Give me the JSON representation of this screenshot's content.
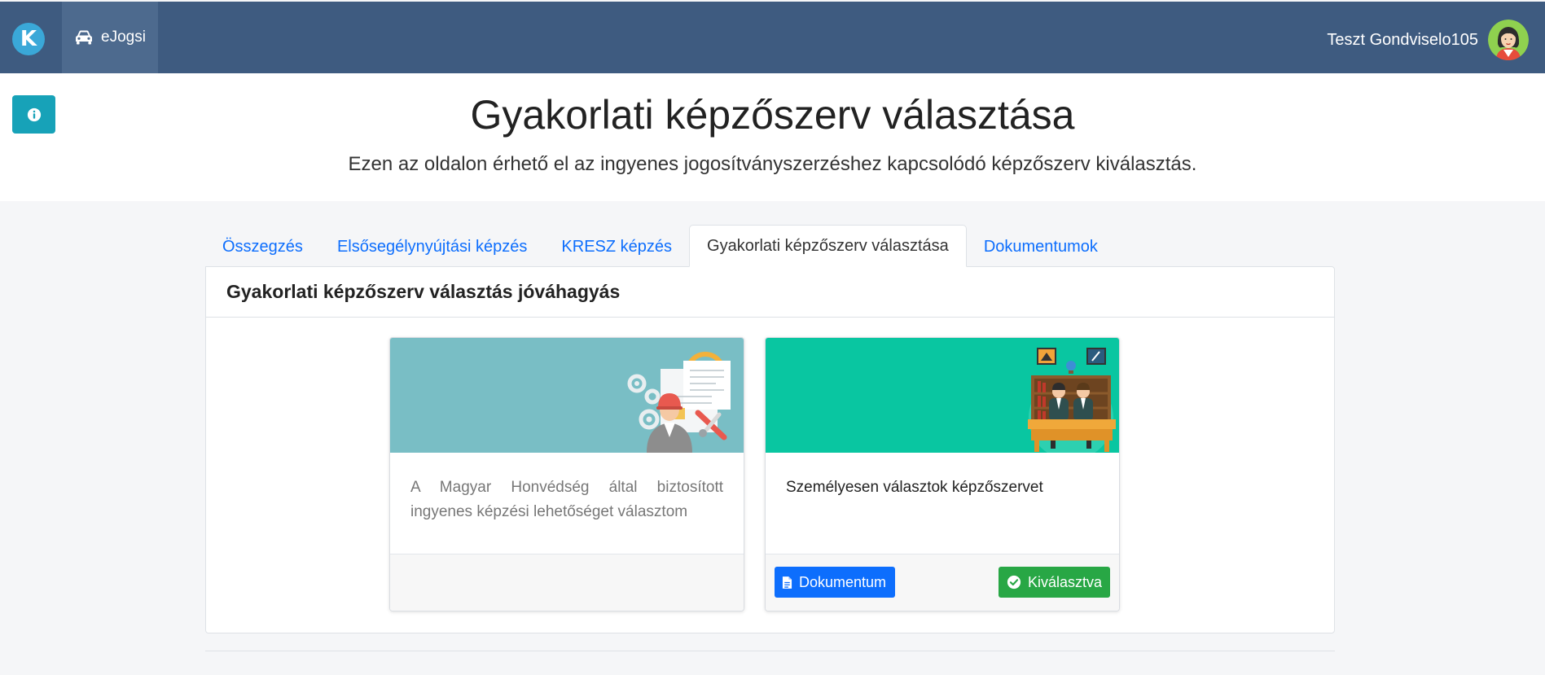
{
  "navbar": {
    "logo_icon": "k-logo-icon",
    "app_label": "eJogsi",
    "app_icon": "car-icon",
    "user_name": "Teszt Gondviselo105",
    "avatar_icon": "user-avatar-icon"
  },
  "header": {
    "info_icon": "info-circle-icon",
    "title": "Gyakorlati képzőszerv választása",
    "subtitle": "Ezen az oldalon érhető el az ingyenes jogosítványszerzéshez kapcsolódó képzőszerv kiválasztás."
  },
  "tabs": [
    {
      "label": "Összegzés",
      "active": false
    },
    {
      "label": "Elsősegélynyújtási képzés",
      "active": false
    },
    {
      "label": "KRESZ képzés",
      "active": false
    },
    {
      "label": "Gyakorlati képzőszerv választása",
      "active": true
    },
    {
      "label": "Dokumentumok",
      "active": false
    }
  ],
  "card": {
    "title": "Gyakorlati képzőszerv választás jóváhagyás",
    "options": [
      {
        "text": "A Magyar Honvédség által biztosított ingyenes képzési lehetőséget választom",
        "image_icon": "engineer-illustration-icon",
        "header_color": "#79bec5",
        "selected": false
      },
      {
        "text": "Személyesen választok képzőszervet",
        "image_icon": "classroom-illustration-icon",
        "header_color": "#09c6a1",
        "selected": true,
        "document_label": "Dokumentum",
        "selected_label": "Kiválasztva"
      }
    ]
  },
  "colors": {
    "navbar": "#3e5b80",
    "info_button": "#17a2b8",
    "primary": "#0d6efd",
    "success": "#28a745"
  }
}
